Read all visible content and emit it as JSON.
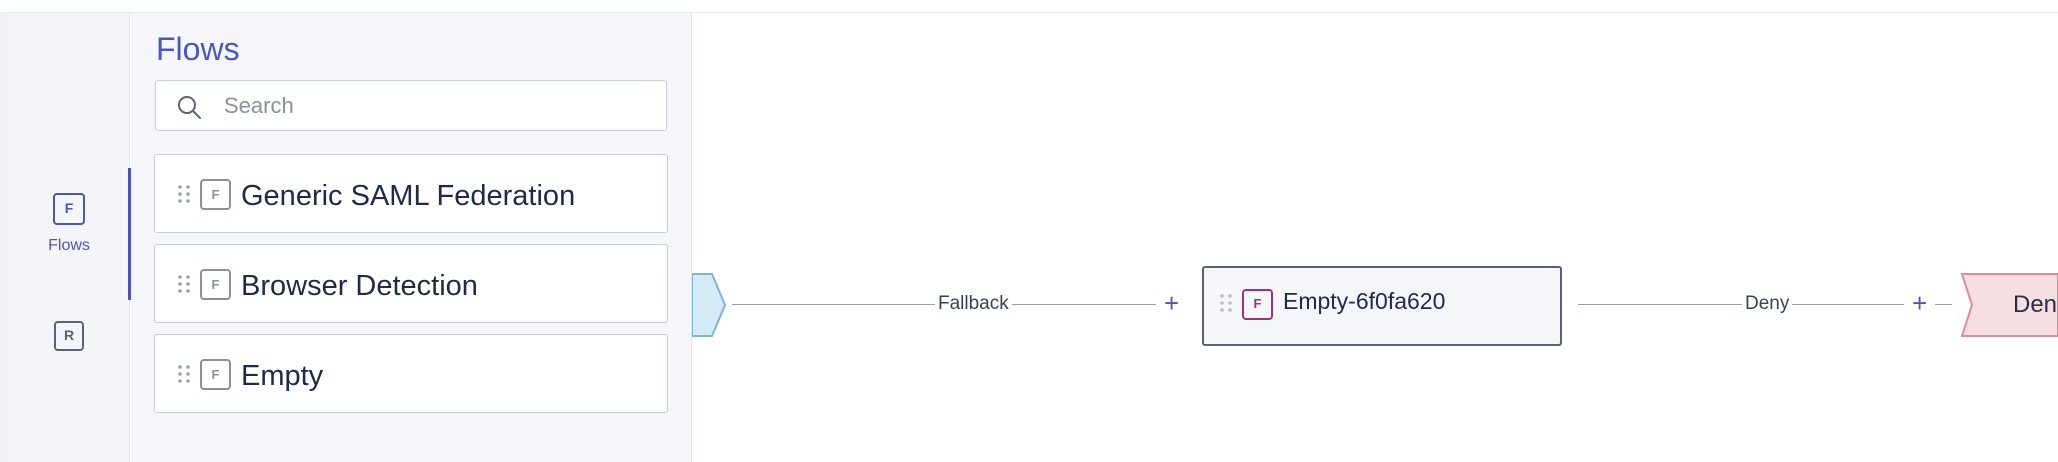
{
  "rail": {
    "flows": {
      "badge": "F",
      "label": "Flows"
    },
    "rules": {
      "badge": "R"
    }
  },
  "panel": {
    "title": "Flows",
    "search": {
      "placeholder": "Search",
      "value": ""
    },
    "flows": [
      {
        "badge": "F",
        "name": "Generic SAML Federation"
      },
      {
        "badge": "F",
        "name": "Browser Detection"
      },
      {
        "badge": "F",
        "name": "Empty"
      }
    ]
  },
  "canvas": {
    "edges": [
      {
        "label": "Fallback",
        "add": "+"
      },
      {
        "label": "Deny",
        "add": "+"
      }
    ],
    "node": {
      "badge": "F",
      "name": "Empty-6f0fa620"
    },
    "deny_node": {
      "label": "Den"
    }
  },
  "colors": {
    "accent": "#4b56c4",
    "node_badge": "#a0327a",
    "start_node": "#d4eaf5",
    "deny_node": "#f6dfe2"
  }
}
